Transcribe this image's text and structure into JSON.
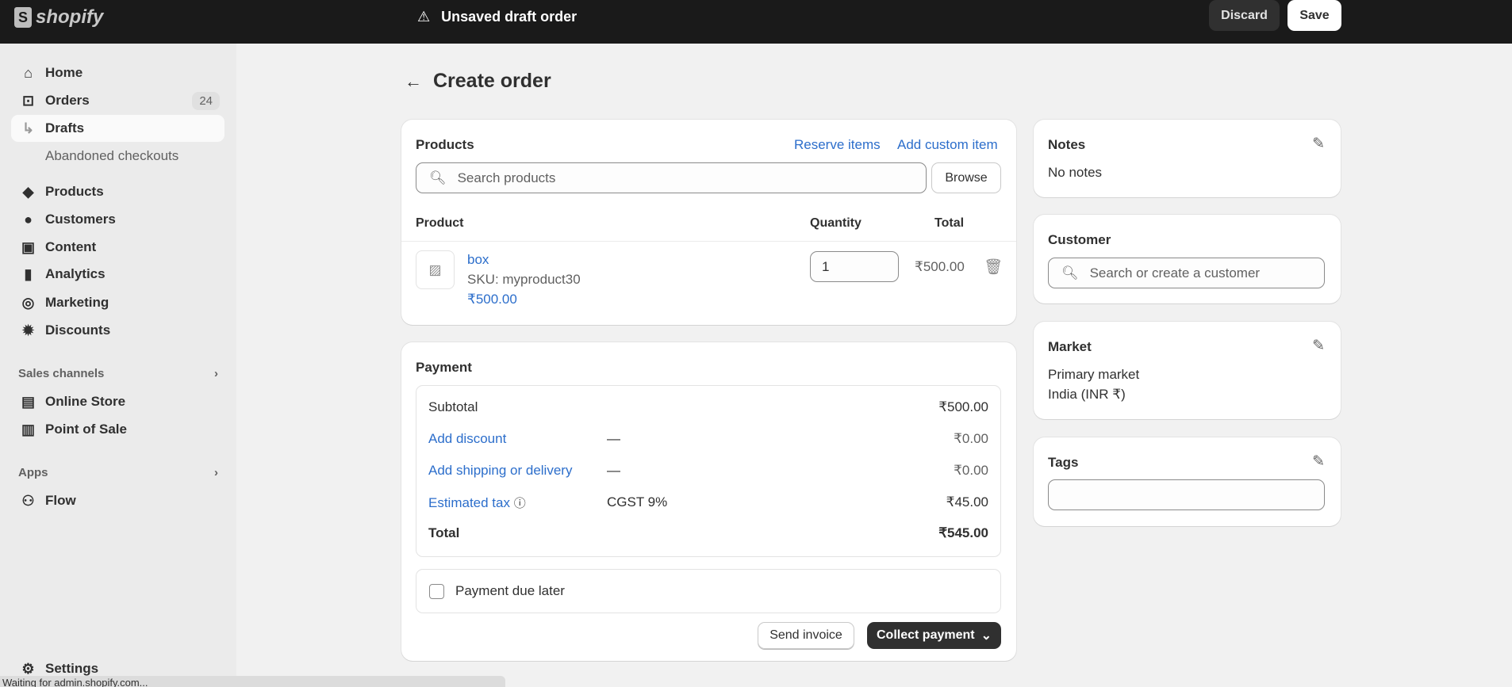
{
  "topbar": {
    "logo": "shopify",
    "title": "Unsaved draft order",
    "discard": "Discard",
    "save": "Save"
  },
  "sidebar": {
    "items": [
      {
        "label": "Home",
        "icon": "home-icon"
      },
      {
        "label": "Orders",
        "badge": "24",
        "icon": "inbox-icon"
      },
      {
        "label": "Drafts"
      },
      {
        "label": "Abandoned checkouts"
      },
      {
        "label": "Products",
        "icon": "tag-icon"
      },
      {
        "label": "Customers",
        "icon": "person-icon"
      },
      {
        "label": "Content",
        "icon": "image-icon"
      },
      {
        "label": "Analytics",
        "icon": "bar-chart-icon"
      },
      {
        "label": "Marketing",
        "icon": "target-icon"
      },
      {
        "label": "Discounts",
        "icon": "discount-icon"
      }
    ],
    "sales_channels": "Sales channels",
    "channels": [
      {
        "label": "Online Store"
      },
      {
        "label": "Point of Sale"
      }
    ],
    "apps": "Apps",
    "app_items": [
      {
        "label": "Flow"
      }
    ],
    "settings": "Settings"
  },
  "status_bar": "Waiting for admin.shopify.com...",
  "page": {
    "title": "Create order"
  },
  "products": {
    "title": "Products",
    "reserve": "Reserve items",
    "add_custom": "Add custom item",
    "search_placeholder": "Search products",
    "browse": "Browse",
    "headers": {
      "product": "Product",
      "quantity": "Quantity",
      "total": "Total"
    },
    "items": [
      {
        "name": "box",
        "sku": "SKU: myproduct30",
        "price": "₹500.00",
        "quantity": "1",
        "total": "₹500.00"
      }
    ]
  },
  "payment": {
    "title": "Payment",
    "rows": [
      {
        "label": "Subtotal",
        "detail": "",
        "value": "₹500.00"
      },
      {
        "label": "Add discount",
        "detail": "—",
        "value": "₹0.00"
      },
      {
        "label": "Add shipping or delivery",
        "detail": "—",
        "value": "₹0.00"
      },
      {
        "label": "Estimated tax",
        "detail": "CGST 9%",
        "value": "₹45.00"
      },
      {
        "label": "Total",
        "detail": "",
        "value": "₹545.00"
      }
    ],
    "due_later": "Payment due later",
    "due_later_checked": false,
    "send_invoice": "Send invoice",
    "collect": "Collect payment"
  },
  "notes": {
    "title": "Notes",
    "text": "No notes"
  },
  "customer": {
    "title": "Customer",
    "placeholder": "Search or create a customer"
  },
  "market": {
    "title": "Market",
    "name": "Primary market",
    "currency": "India (INR ₹)"
  },
  "tags": {
    "title": "Tags",
    "value": ""
  }
}
